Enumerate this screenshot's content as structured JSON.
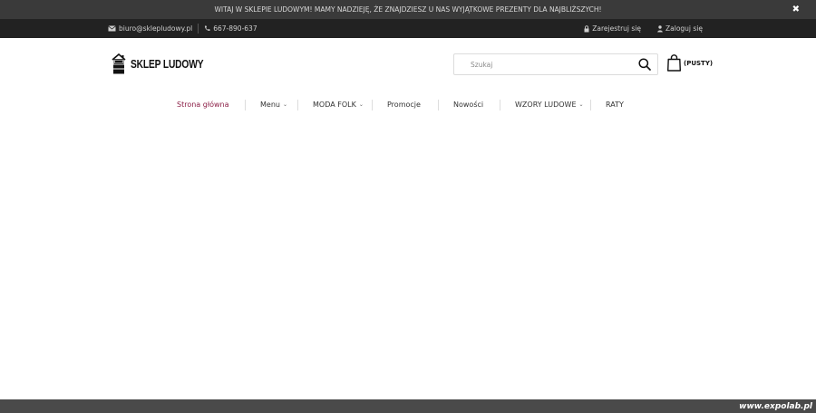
{
  "announcement": {
    "text": "WITAJ W SKLEPIE LUDOWYM! MAMY NADZIEJĘ, ŻE ZNAJDZIESZ U NAS WYJĄTKOWE PREZENTY DLA NAJBLIŻSZYCH!",
    "close_icon": "close-icon",
    "close_glyph": "✖"
  },
  "contact": {
    "email": "biuro@sklepludowy.pl",
    "phone": "667-890-637"
  },
  "account": {
    "register": "Zarejestruj się",
    "login": "Zaloguj się"
  },
  "logo": {
    "text": "SKLEP LUDOWY"
  },
  "search": {
    "placeholder": "Szukaj"
  },
  "cart": {
    "label": "(PUSTY)"
  },
  "nav": {
    "items": [
      {
        "label": "Strona główna",
        "active": true,
        "dropdown": false
      },
      {
        "label": "Menu",
        "active": false,
        "dropdown": true
      },
      {
        "label": "MODA FOLK",
        "active": false,
        "dropdown": true
      },
      {
        "label": "Promocje",
        "active": false,
        "dropdown": false
      },
      {
        "label": "Nowości",
        "active": false,
        "dropdown": false
      },
      {
        "label": "WZORY LUDOWE",
        "active": false,
        "dropdown": true
      },
      {
        "label": "RATY",
        "active": false,
        "dropdown": false
      }
    ]
  },
  "footer": {
    "watermark": "www.expolab.pl"
  },
  "colors": {
    "announcement_bg": "#3a3a3a",
    "infobar_bg": "#222222",
    "accent": "#8b1e46",
    "footer_bg": "#4a4a4a"
  }
}
